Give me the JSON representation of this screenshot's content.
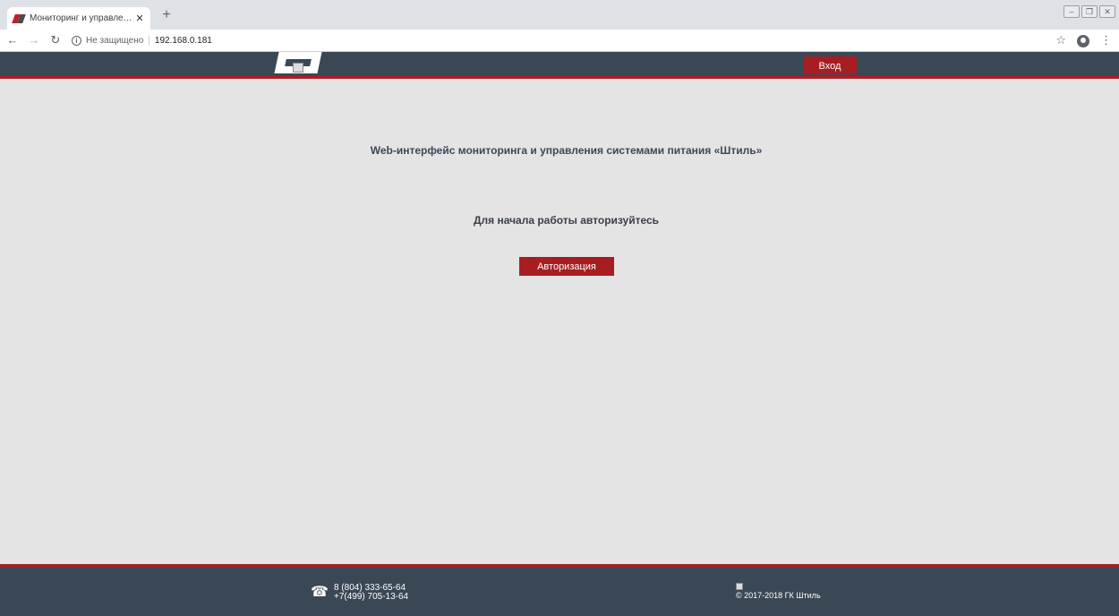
{
  "browser": {
    "tab_title": "Мониторинг и управление сист",
    "tab_close": "✕",
    "new_tab": "+",
    "security_label": "Не защищено",
    "url": "192.168.0.181",
    "icons": [
      "back-icon",
      "forward-icon",
      "reload-icon",
      "info-icon",
      "star-icon",
      "profile-icon",
      "menu-icon"
    ]
  },
  "header": {
    "login_label": "Вход"
  },
  "main": {
    "title": "Web-интерфейс мониторинга и управления системами питания «Штиль»",
    "prompt": "Для начала работы авторизуйтесь",
    "auth_button": "Авторизация"
  },
  "footer": {
    "phones": [
      "8 (804) 333-65-64",
      "+7(499) 705-13-64"
    ],
    "copyright": "© 2017-2018 ГК Штиль"
  },
  "colors": {
    "header_bg": "#3a4856",
    "accent_red": "#a61e22",
    "page_bg": "#e4e4e4"
  }
}
